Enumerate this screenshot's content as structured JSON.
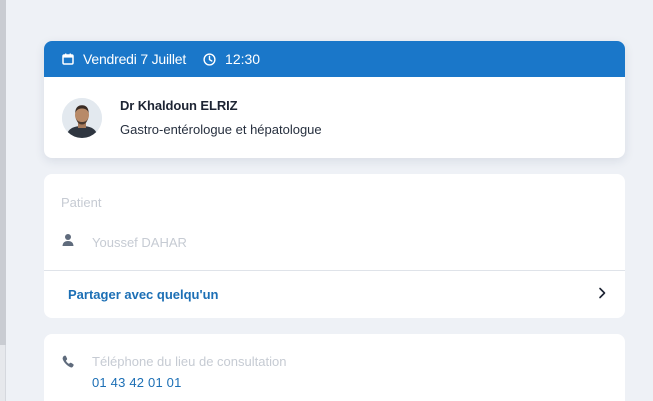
{
  "appointment": {
    "date": "Vendredi 7 Juillet",
    "time": "12:30",
    "calendar_icon": "calendar-icon",
    "clock_icon": "clock-icon",
    "header_color": "#1a77c9"
  },
  "doctor": {
    "name": "Dr Khaldoun ELRIZ",
    "specialty": "Gastro-entérologue et hépatologue"
  },
  "patient": {
    "label": "Patient",
    "name": "Youssef DAHAR",
    "person_icon": "person-icon"
  },
  "share": {
    "label": "Partager avec quelqu'un",
    "chevron_icon": "chevron-right-icon"
  },
  "location": {
    "phone_label": "Téléphone du lieu de consultation",
    "phone_number": "01 43 42 01 01",
    "phone_icon": "phone-icon"
  },
  "colors": {
    "accent": "#1a77c9",
    "link": "#1c6fb5",
    "muted": "#c6cbd3",
    "background": "#eef1f6"
  }
}
